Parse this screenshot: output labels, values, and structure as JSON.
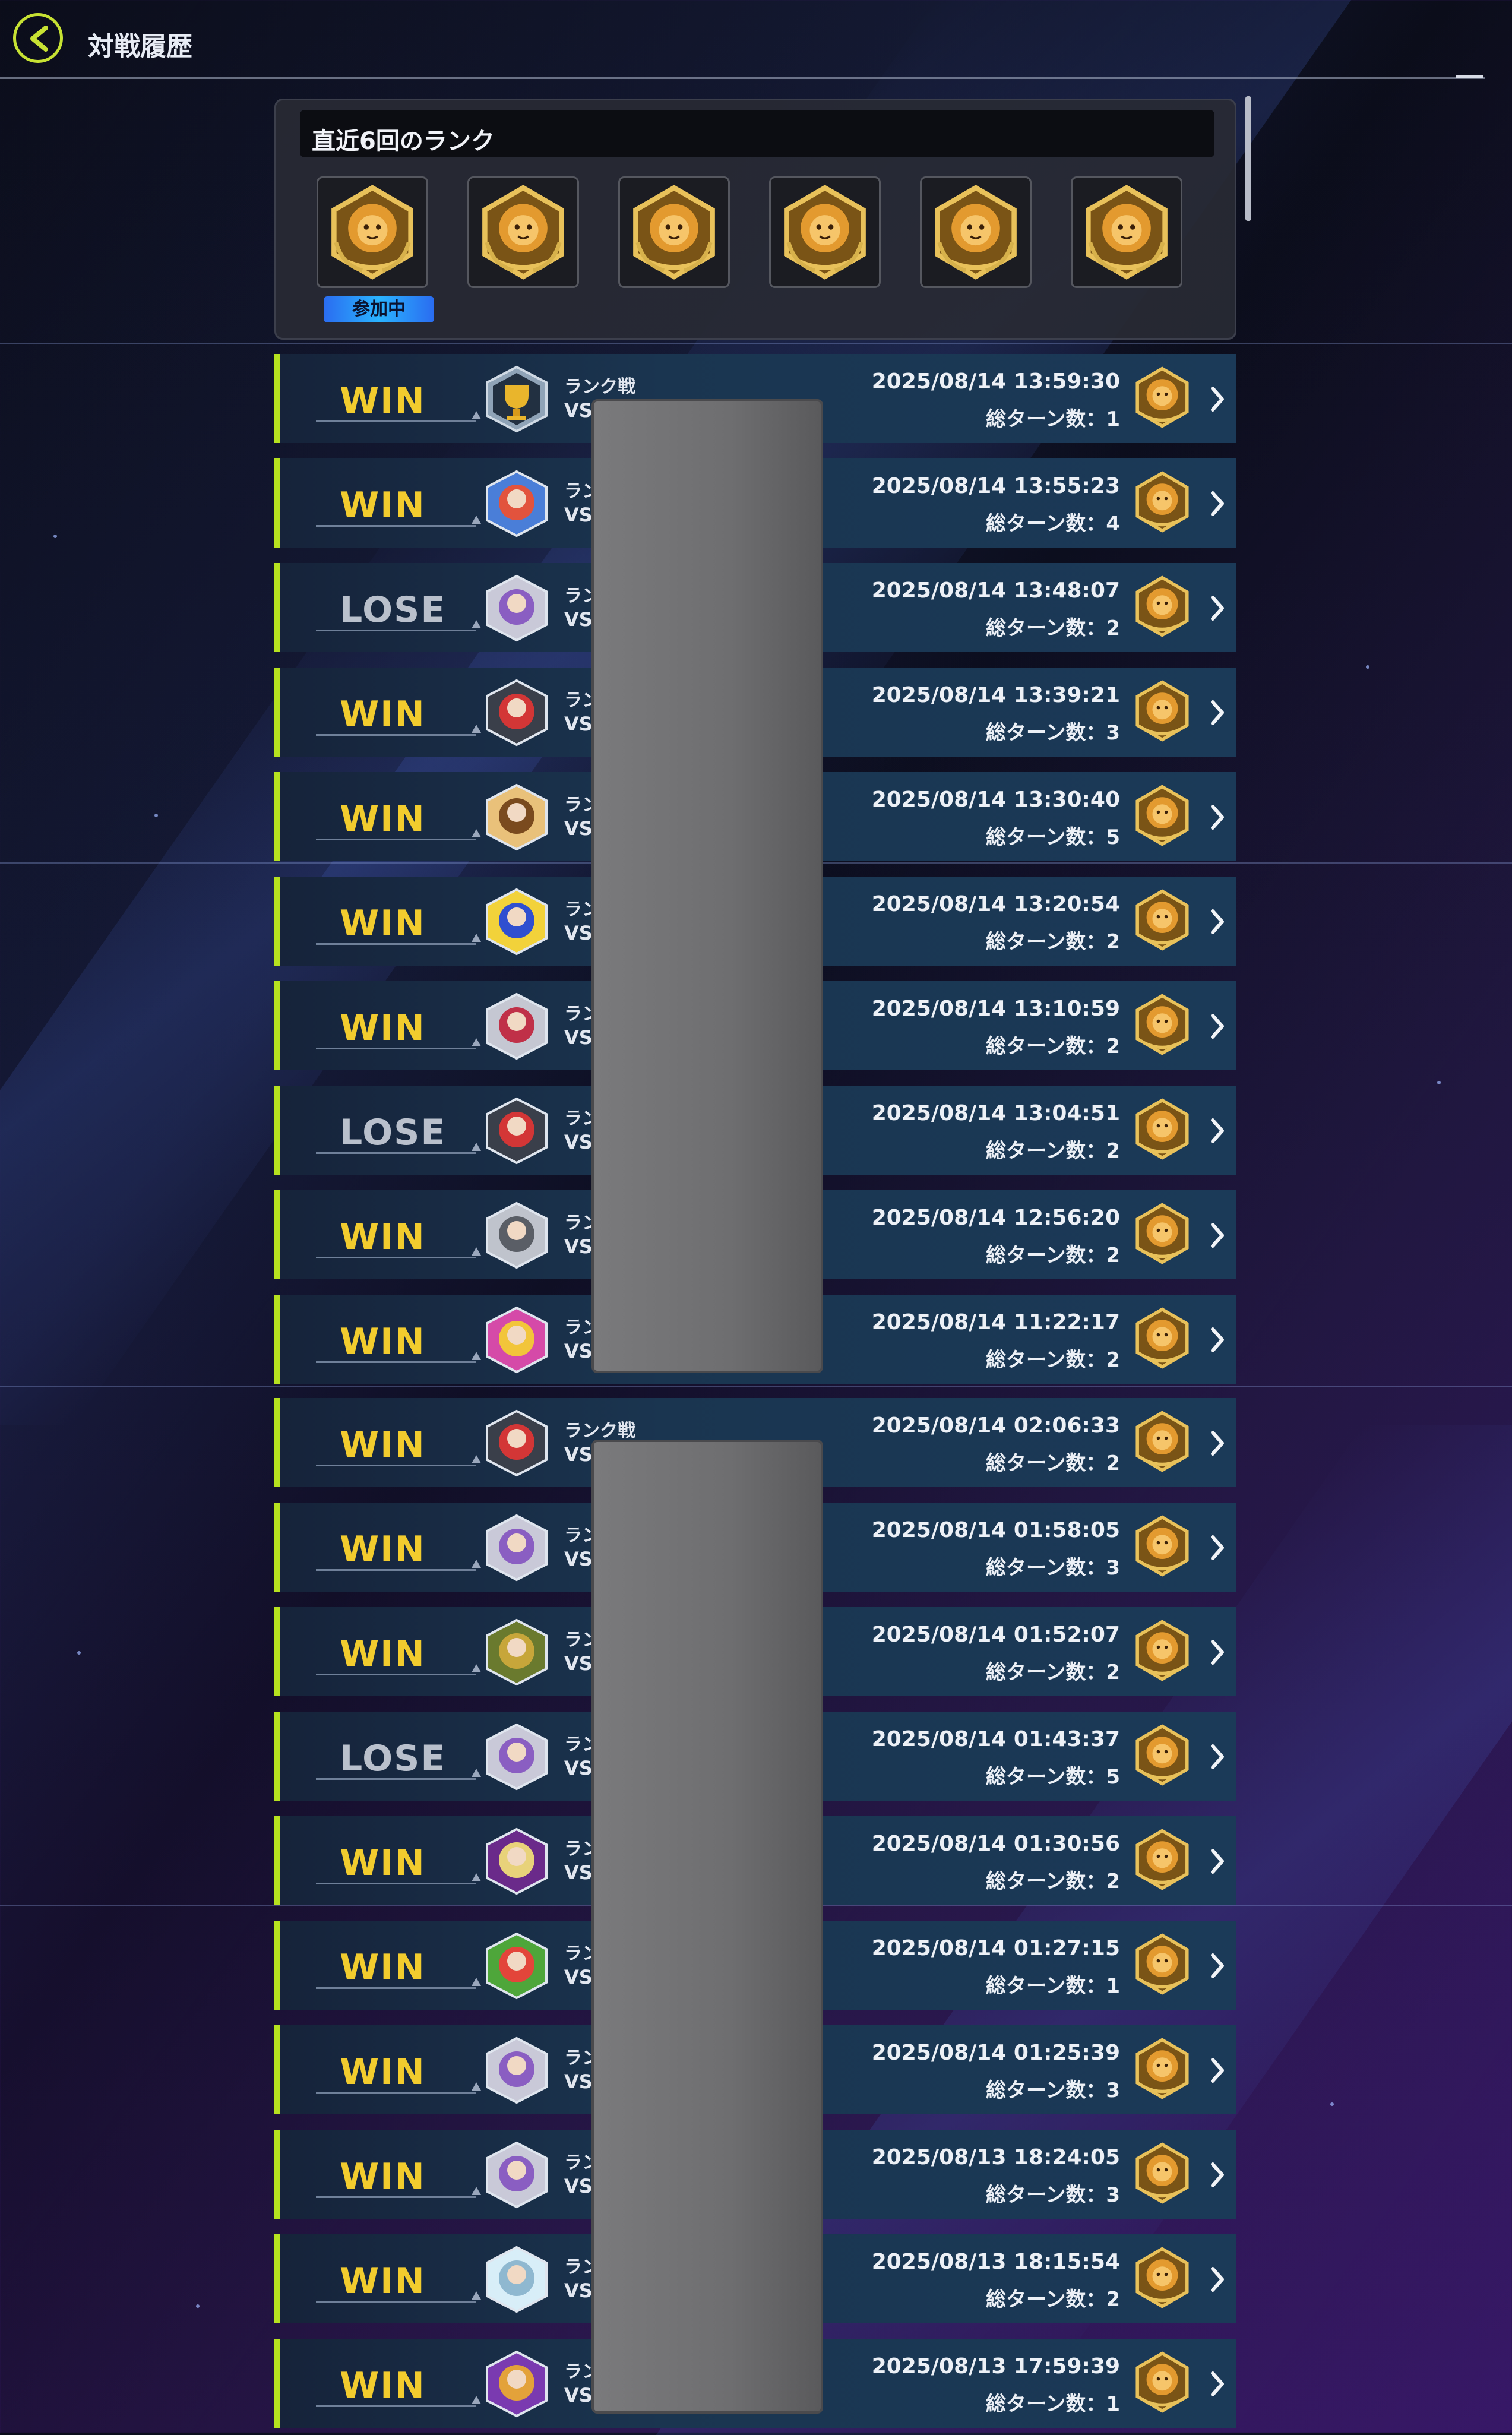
{
  "header": {
    "title": "対戦履歴"
  },
  "rank_panel": {
    "title": "直近6回のランク",
    "medals": [
      "rank-medal-icon",
      "rank-medal-icon",
      "rank-medal-icon",
      "rank-medal-icon",
      "rank-medal-icon",
      "rank-medal-icon"
    ],
    "participating_label": "参加中"
  },
  "colors": {
    "win": "#f2cc2e",
    "lose": "#b9c0cc",
    "accent": "#b6e21f",
    "row": "#1b3a58"
  },
  "matches": [
    {
      "result": "WIN",
      "mode": "ランク戦",
      "vs": "VS",
      "datetime": "2025/08/14 13:59:30",
      "turns": "総ターン数：1",
      "avatar": "trophy-avatar-icon"
    },
    {
      "result": "WIN",
      "mode": "ラン",
      "vs": "VS",
      "datetime": "2025/08/14 13:55:23",
      "turns": "総ターン数：4",
      "avatar": "character-avatar-icon"
    },
    {
      "result": "LOSE",
      "mode": "ラン",
      "vs": "VS",
      "datetime": "2025/08/14 13:48:07",
      "turns": "総ターン数：2",
      "avatar": "character-avatar-icon"
    },
    {
      "result": "WIN",
      "mode": "ラン",
      "vs": "VS",
      "datetime": "2025/08/14 13:39:21",
      "turns": "総ターン数：3",
      "avatar": "character-avatar-icon"
    },
    {
      "result": "WIN",
      "mode": "ラン",
      "vs": "VS",
      "datetime": "2025/08/14 13:30:40",
      "turns": "総ターン数：5",
      "avatar": "character-avatar-icon"
    },
    {
      "result": "WIN",
      "mode": "ラン",
      "vs": "VS",
      "datetime": "2025/08/14 13:20:54",
      "turns": "総ターン数：2",
      "avatar": "character-avatar-icon"
    },
    {
      "result": "WIN",
      "mode": "ラン",
      "vs": "VS",
      "datetime": "2025/08/14 13:10:59",
      "turns": "総ターン数：2",
      "avatar": "character-avatar-icon"
    },
    {
      "result": "LOSE",
      "mode": "ラン",
      "vs": "VS",
      "datetime": "2025/08/14 13:04:51",
      "turns": "総ターン数：2",
      "avatar": "character-avatar-icon"
    },
    {
      "result": "WIN",
      "mode": "ラン",
      "vs": "VS",
      "datetime": "2025/08/14 12:56:20",
      "turns": "総ターン数：2",
      "avatar": "character-avatar-icon"
    },
    {
      "result": "WIN",
      "mode": "ラン",
      "vs": "VS",
      "datetime": "2025/08/14 11:22:17",
      "turns": "総ターン数：2",
      "avatar": "character-avatar-icon"
    },
    {
      "result": "WIN",
      "mode": "ランク戦",
      "vs": "VS",
      "datetime": "2025/08/14 02:06:33",
      "turns": "総ターン数：2",
      "avatar": "character-avatar-icon"
    },
    {
      "result": "WIN",
      "mode": "ラン",
      "vs": "VS",
      "datetime": "2025/08/14 01:58:05",
      "turns": "総ターン数：3",
      "avatar": "character-avatar-icon"
    },
    {
      "result": "WIN",
      "mode": "ラン",
      "vs": "VS",
      "datetime": "2025/08/14 01:52:07",
      "turns": "総ターン数：2",
      "avatar": "character-avatar-icon"
    },
    {
      "result": "LOSE",
      "mode": "ラン",
      "vs": "VS",
      "datetime": "2025/08/14 01:43:37",
      "turns": "総ターン数：5",
      "avatar": "character-avatar-icon"
    },
    {
      "result": "WIN",
      "mode": "ラン",
      "vs": "VS",
      "datetime": "2025/08/14 01:30:56",
      "turns": "総ターン数：2",
      "avatar": "character-avatar-icon"
    },
    {
      "result": "WIN",
      "mode": "ラン",
      "vs": "VS",
      "datetime": "2025/08/14 01:27:15",
      "turns": "総ターン数：1",
      "avatar": "character-avatar-icon"
    },
    {
      "result": "WIN",
      "mode": "ラン",
      "vs": "VS",
      "datetime": "2025/08/14 01:25:39",
      "turns": "総ターン数：3",
      "avatar": "character-avatar-icon"
    },
    {
      "result": "WIN",
      "mode": "ラン",
      "vs": "VS",
      "datetime": "2025/08/13 18:24:05",
      "turns": "総ターン数：3",
      "avatar": "character-avatar-icon"
    },
    {
      "result": "WIN",
      "mode": "ラン",
      "vs": "VS",
      "datetime": "2025/08/13 18:15:54",
      "turns": "総ターン数：2",
      "avatar": "character-avatar-icon"
    },
    {
      "result": "WIN",
      "mode": "ラン",
      "vs": "VS",
      "datetime": "2025/08/13 17:59:39",
      "turns": "総ターン数：1",
      "avatar": "character-avatar-icon"
    }
  ]
}
